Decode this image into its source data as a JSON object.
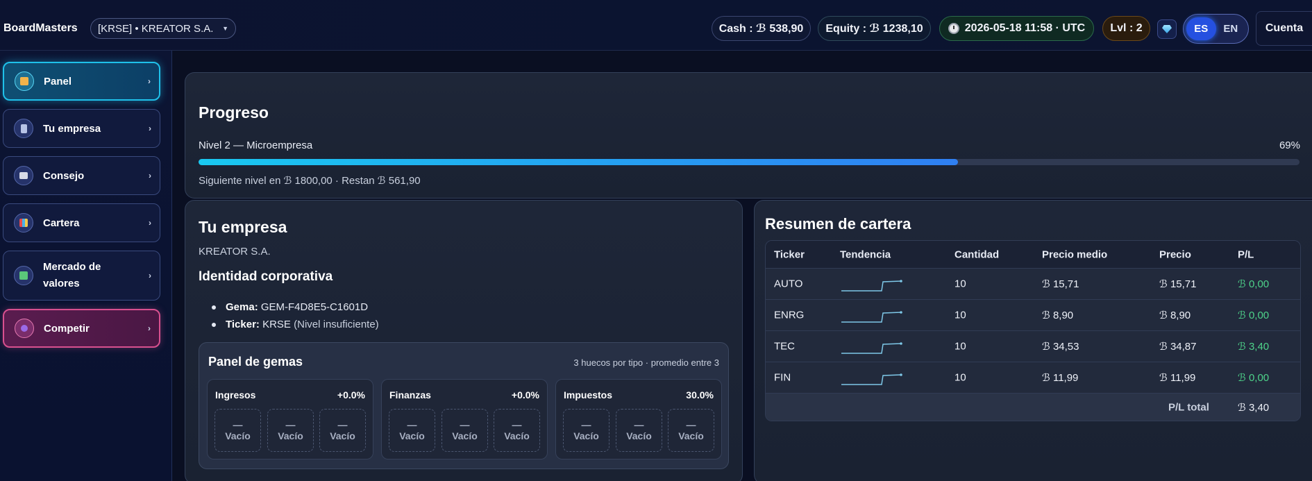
{
  "topbar": {
    "brand": "BoardMasters",
    "company_select": "[KRSE] • KREATOR S.A.",
    "cash": "Cash : ℬ 538,90",
    "equity": "Equity : ℬ 1238,10",
    "datetime": "2026-05-18 11:58 · UTC",
    "level": "Lvl : 2",
    "lang_es": "ES",
    "lang_en": "EN",
    "account": "Cuenta"
  },
  "sidebar": {
    "items": [
      {
        "label": "Panel",
        "icon": "house-icon",
        "active": true
      },
      {
        "label": "Tu empresa",
        "icon": "building-icon"
      },
      {
        "label": "Consejo",
        "icon": "bank-icon"
      },
      {
        "label": "Cartera",
        "icon": "chart-icon"
      },
      {
        "label": "Mercado de valores",
        "icon": "stock-chart-icon"
      },
      {
        "label": "Competir",
        "icon": "heart-icon"
      }
    ]
  },
  "progress": {
    "title": "Progreso",
    "level_label": "Nivel 2 — Microempresa",
    "percent_text": "69%",
    "percent": 69,
    "next_text": "Siguiente nivel en ℬ 1800,00 · Restan ℬ 561,90"
  },
  "company": {
    "title": "Tu empresa",
    "name": "KREATOR S.A.",
    "identity_title": "Identidad corporativa",
    "gem_label": "Gema:",
    "gem_value": "GEM-F4D8E5-C1601D",
    "ticker_label": "Ticker:",
    "ticker_value": "KRSE",
    "ticker_note": "(Nivel insuficiente)",
    "gem_panel": {
      "title": "Panel de gemas",
      "subtitle": "3 huecos por tipo · promedio entre 3",
      "groups": [
        {
          "name": "Ingresos",
          "value": "+0.0%",
          "slots": [
            "Vacío",
            "Vacío",
            "Vacío"
          ]
        },
        {
          "name": "Finanzas",
          "value": "+0.0%",
          "slots": [
            "Vacío",
            "Vacío",
            "Vacío"
          ]
        },
        {
          "name": "Impuestos",
          "value": "30.0%",
          "slots": [
            "Vacío",
            "Vacío",
            "Vacío"
          ]
        }
      ],
      "empty_dash": "—"
    }
  },
  "portfolio": {
    "title": "Resumen de cartera",
    "headers": [
      "Ticker",
      "Tendencia",
      "Cantidad",
      "Precio medio",
      "Precio",
      "P/L"
    ],
    "rows": [
      {
        "ticker": "AUTO",
        "qty": "10",
        "avg": "ℬ 15,71",
        "price": "ℬ 15,71",
        "pl": "ℬ 0,00"
      },
      {
        "ticker": "ENRG",
        "qty": "10",
        "avg": "ℬ 8,90",
        "price": "ℬ 8,90",
        "pl": "ℬ 0,00"
      },
      {
        "ticker": "TEC",
        "qty": "10",
        "avg": "ℬ 34,53",
        "price": "ℬ 34,87",
        "pl": "ℬ 3,40"
      },
      {
        "ticker": "FIN",
        "qty": "10",
        "avg": "ℬ 11,99",
        "price": "ℬ 11,99",
        "pl": "ℬ 0,00"
      }
    ],
    "total_label": "P/L total",
    "total_value": "ℬ 3,40"
  },
  "colors": {
    "accent": "#1fc1ea",
    "positive": "#4ed38a",
    "compete": "#d8508f"
  }
}
